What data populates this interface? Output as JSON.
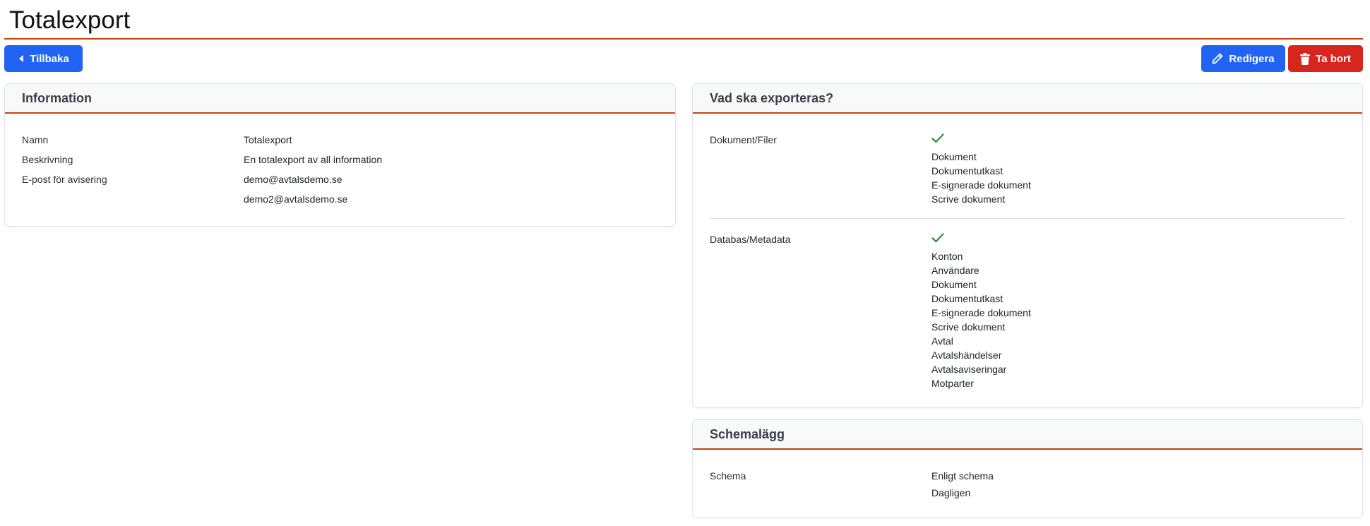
{
  "page": {
    "title": "Totalexport"
  },
  "toolbar": {
    "back_label": "Tillbaka",
    "edit_label": "Redigera",
    "delete_label": "Ta bort"
  },
  "information": {
    "title": "Information",
    "rows": [
      {
        "label": "Namn",
        "value": "Totalexport"
      },
      {
        "label": "Beskrivning",
        "value": "En totalexport av all information"
      },
      {
        "label": "E-post för avisering",
        "values": [
          "demo@avtalsdemo.se",
          "demo2@avtalsdemo.se"
        ]
      }
    ]
  },
  "export": {
    "title": "Vad ska exporteras?",
    "groups": [
      {
        "label": "Dokument/Filer",
        "enabled": true,
        "items": [
          "Dokument",
          "Dokumentutkast",
          "E-signerade dokument",
          "Scrive dokument"
        ]
      },
      {
        "label": "Databas/Metadata",
        "enabled": true,
        "items": [
          "Konton",
          "Användare",
          "Dokument",
          "Dokumentutkast",
          "E-signerade dokument",
          "Scrive dokument",
          "Avtal",
          "Avtalshändelser",
          "Avtalsaviseringar",
          "Motparter"
        ]
      }
    ]
  },
  "schedule": {
    "title": "Schemalägg",
    "label": "Schema",
    "values": [
      "Enligt schema",
      "Dagligen"
    ]
  },
  "colors": {
    "primary": "#2163f2",
    "danger": "#d7261e",
    "accent_rule": "#c9400f",
    "check": "#2e8b3e"
  }
}
